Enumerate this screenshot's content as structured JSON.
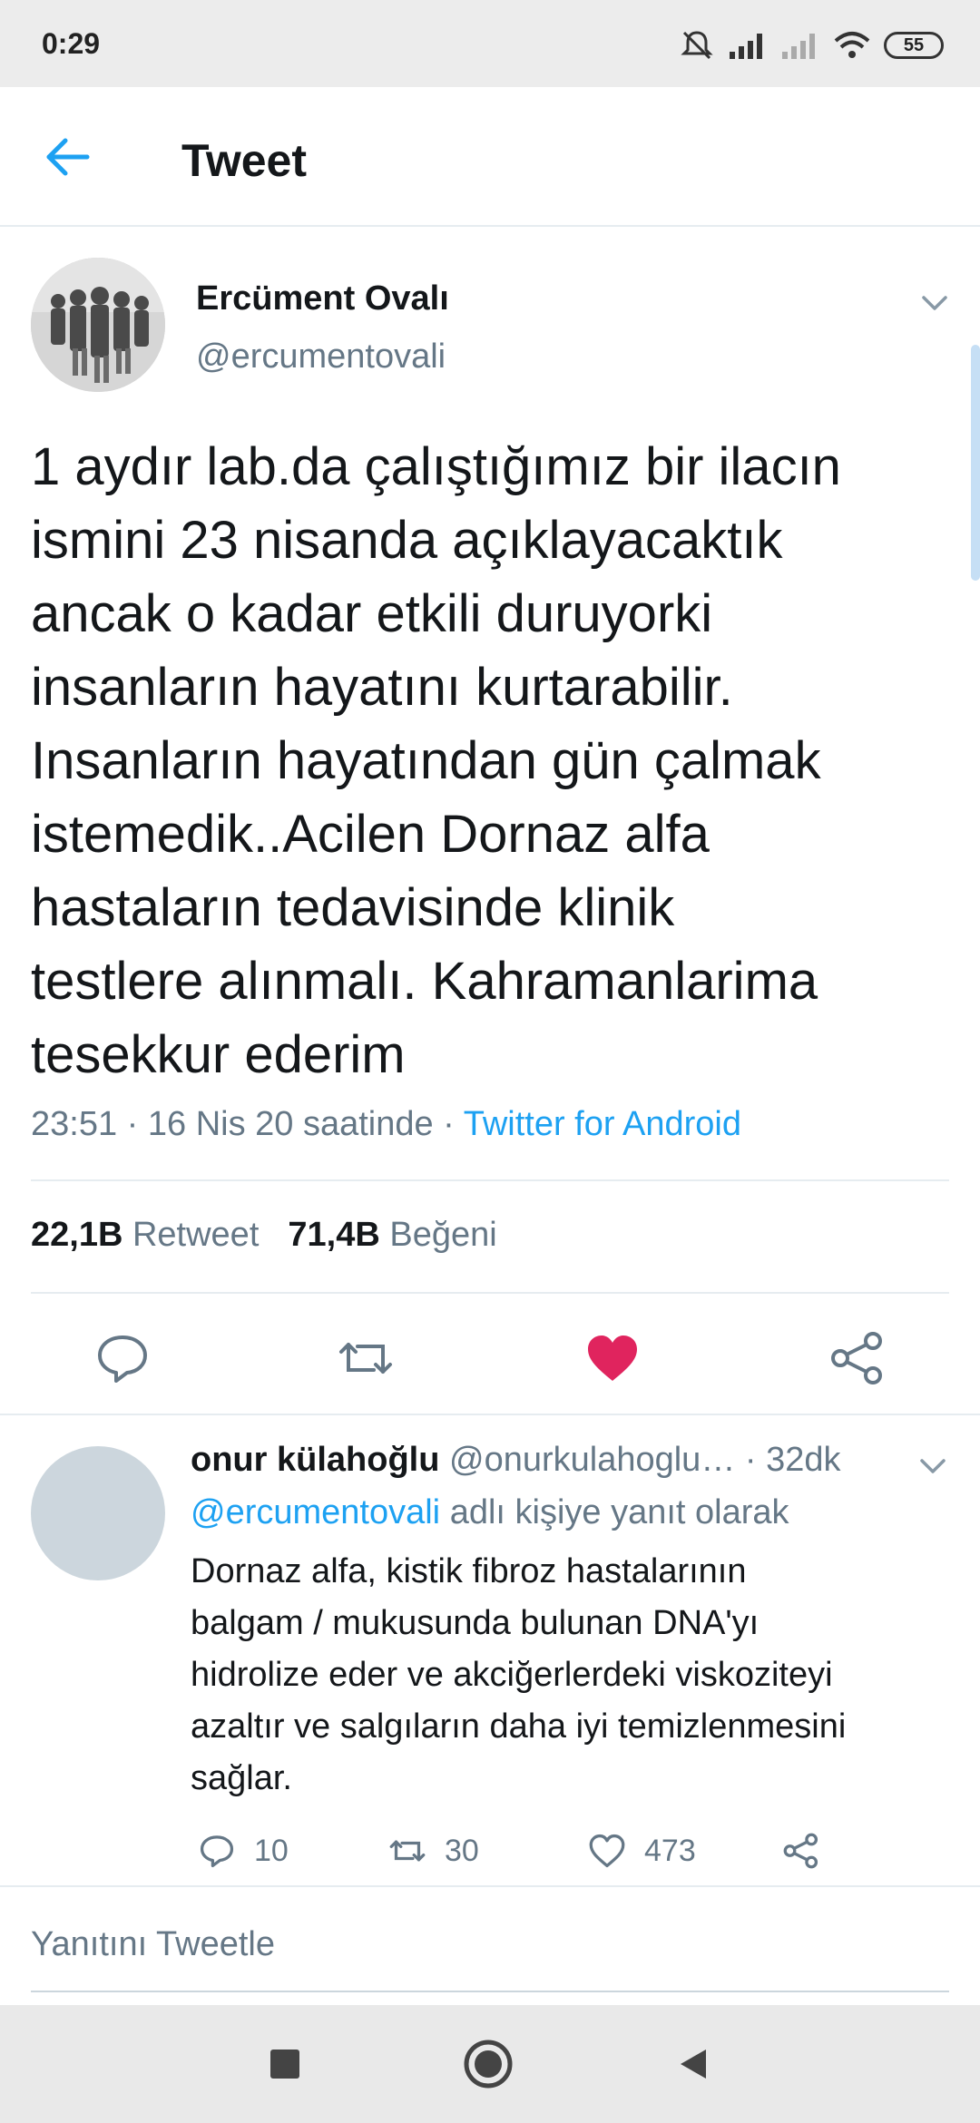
{
  "status_bar": {
    "time": "0:29",
    "battery": "55"
  },
  "header": {
    "title": "Tweet"
  },
  "tweet": {
    "author_name": "Ercüment Ovalı",
    "author_handle": "@ercumentovali",
    "text": "1 aydır lab.da çalıştığımız bir ilacın\nismini 23 nisanda açıklayacaktık\nancak o kadar etkili duruyorki\ninsanların hayatını kurtarabilir.\nInsanların hayatından gün çalmak\nistemedik..Acilen Dornaz alfa\nhastaların tedavisinde klinik\ntestlere alınmalı. Kahramanlarima\ntesekkur ederim",
    "timestamp": "23:51 · 16 Nis 20 saatinde · ",
    "source": "Twitter for Android",
    "retweet_count": "22,1B",
    "retweet_label": "Retweet",
    "like_count": "71,4B",
    "like_label": "Beğeni"
  },
  "reply": {
    "author_name": "onur külahoğlu",
    "author_handle": "@onurkulahoglu…",
    "time": "· 32dk",
    "reply_to_mention": "@ercumentovali",
    "reply_to_suffix": " adlı kişiye yanıt olarak",
    "text": "Dornaz alfa, kistik fibroz hastalarının\nbalgam / mukusunda bulunan DNA'yı\nhidrolize eder ve akciğerlerdeki viskoziteyi\nazaltır ve salgıların daha iyi temizlenmesini\nsağlar.",
    "reply_count": "10",
    "retweet_count": "30",
    "like_count": "473"
  },
  "compose": {
    "placeholder": "Yanıtını Tweetle"
  },
  "colors": {
    "accent": "#1da1f2",
    "like": "#e0245e",
    "muted": "#657786",
    "text": "#14171a"
  },
  "icons": {
    "back": "arrow-left-icon",
    "caret": "chevron-down-icon",
    "reply": "speech-bubble-icon",
    "retweet": "retweet-icon",
    "like": "heart-icon",
    "share": "share-icon"
  }
}
